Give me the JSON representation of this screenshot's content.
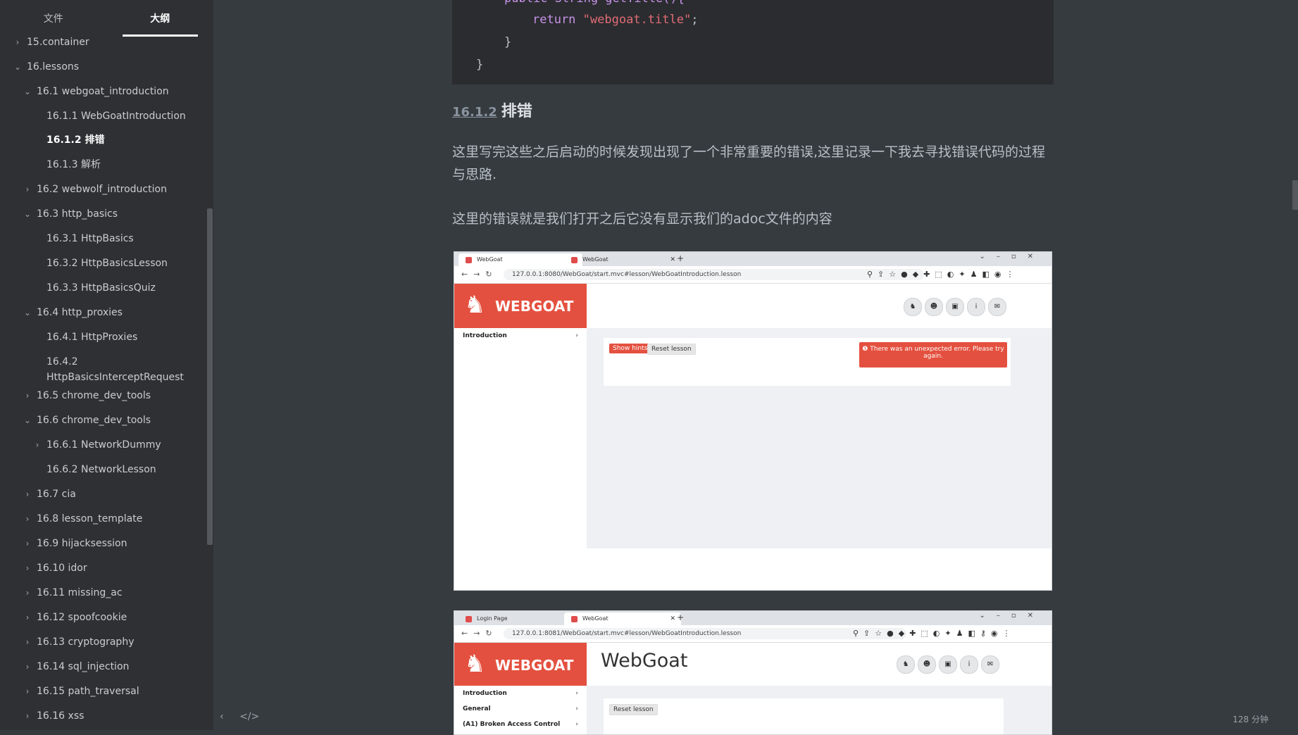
{
  "sidebar": {
    "tabs": [
      "文件",
      "大纲"
    ],
    "outline": [
      {
        "label": "15.container",
        "level": 0,
        "chev": "›"
      },
      {
        "label": "16.lessons",
        "level": 0,
        "chev": "⌄"
      },
      {
        "label": "16.1 webgoat_introduction",
        "level": 1,
        "chev": "⌄"
      },
      {
        "label": "16.1.1 WebGoatIntroduction",
        "level": 2,
        "chev": ""
      },
      {
        "label": "16.1.2 排错",
        "level": 2,
        "chev": "",
        "active": true
      },
      {
        "label": "16.1.3 解析",
        "level": 2,
        "chev": ""
      },
      {
        "label": "16.2 webwolf_introduction",
        "level": 1,
        "chev": "›"
      },
      {
        "label": "16.3 http_basics",
        "level": 1,
        "chev": "⌄"
      },
      {
        "label": "16.3.1 HttpBasics",
        "level": 2,
        "chev": ""
      },
      {
        "label": "16.3.2 HttpBasicsLesson",
        "level": 2,
        "chev": ""
      },
      {
        "label": "16.3.3 HttpBasicsQuiz",
        "level": 2,
        "chev": ""
      },
      {
        "label": "16.4 http_proxies",
        "level": 1,
        "chev": "⌄"
      },
      {
        "label": "16.4.1 HttpProxies",
        "level": 2,
        "chev": ""
      },
      {
        "label": "16.4.2",
        "label2": "HttpBasicsInterceptRequest",
        "level": 2,
        "chev": ""
      },
      {
        "label": "16.5 chrome_dev_tools",
        "level": 1,
        "chev": "›"
      },
      {
        "label": "16.6 chrome_dev_tools",
        "level": 1,
        "chev": "⌄"
      },
      {
        "label": "16.6.1 NetworkDummy",
        "level": 2,
        "chev": "›"
      },
      {
        "label": "16.6.2 NetworkLesson",
        "level": 2,
        "chev": ""
      },
      {
        "label": "16.7 cia",
        "level": 1,
        "chev": "›"
      },
      {
        "label": "16.8 lesson_template",
        "level": 1,
        "chev": "›"
      },
      {
        "label": "16.9 hijacksession",
        "level": 1,
        "chev": "›"
      },
      {
        "label": "16.10 idor",
        "level": 1,
        "chev": "›"
      },
      {
        "label": "16.11 missing_ac",
        "level": 1,
        "chev": "›"
      },
      {
        "label": "16.12 spoofcookie",
        "level": 1,
        "chev": "›"
      },
      {
        "label": "16.13 cryptography",
        "level": 1,
        "chev": "›"
      },
      {
        "label": "16.14 sql_injection",
        "level": 1,
        "chev": "›"
      },
      {
        "label": "16.15 path_traversal",
        "level": 1,
        "chev": "›"
      },
      {
        "label": "16.16 xss",
        "level": 1,
        "chev": "›"
      }
    ],
    "footer_icons": [
      "chevron-left-icon",
      "code-icon"
    ]
  },
  "status": {
    "word_count": "128 分钟"
  },
  "code": {
    "line1": "public String getTitle(){",
    "return_kw": "return",
    "return_str": "\"webgoat.title\"",
    "semicolon": ";",
    "brace1": "}",
    "brace2": "}"
  },
  "heading": {
    "number": "16.1.2",
    "text": "排错"
  },
  "paragraphs": [
    "这里写完这些之后启动的时候发现出现了一个非常重要的错误,这里记录一下我去寻找错误代码的过程与思路.",
    "这里的错误就是我们打开之后它没有显示我们的adoc文件的内容"
  ],
  "screenshot1": {
    "tabs": [
      "WebGoat",
      "WebGoat"
    ],
    "url": "127.0.0.1:8080/WebGoat/start.mvc#lesson/WebGoatIntroduction.lesson",
    "brand": "WEBGOAT",
    "menu": [
      "Introduction"
    ],
    "show_hints": "Show hints",
    "reset": "Reset lesson",
    "error": "There was an unexpected error. Please try again."
  },
  "screenshot2": {
    "tabs": [
      "Login Page",
      "WebGoat"
    ],
    "url": "127.0.0.1:8081/WebGoat/start.mvc#lesson/WebGoatIntroduction.lesson",
    "brand": "WEBGOAT",
    "title": "WebGoat",
    "menu": [
      "Introduction",
      "General",
      "(A1) Broken Access Control"
    ],
    "reset": "Reset lesson"
  }
}
